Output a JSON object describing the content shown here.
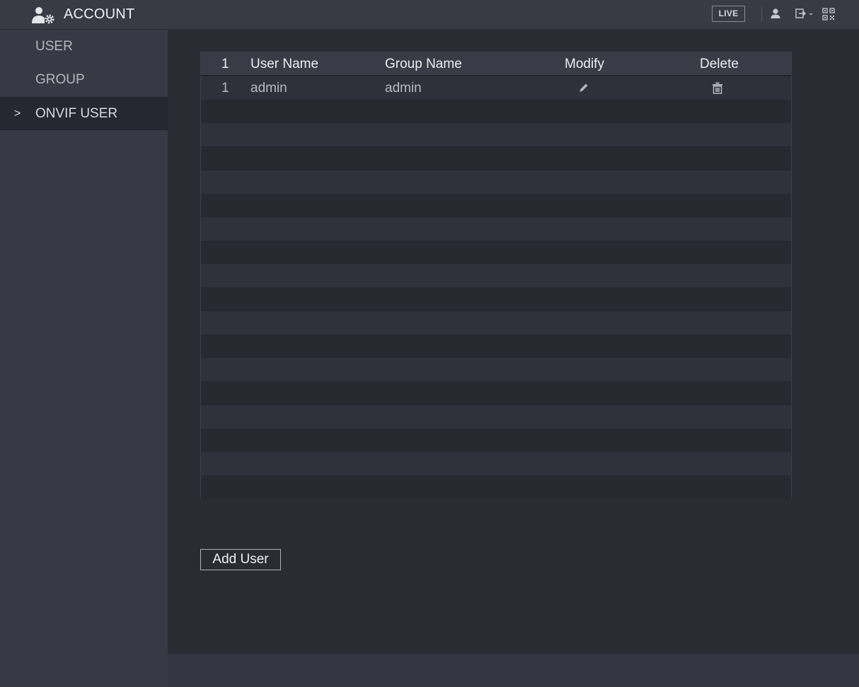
{
  "header": {
    "title": "ACCOUNT",
    "live_label": "LIVE",
    "icons": [
      "account-settings-icon",
      "user-icon",
      "logout-icon",
      "qr-code-icon"
    ]
  },
  "sidebar": {
    "items": [
      {
        "label": "USER",
        "active": false
      },
      {
        "label": "GROUP",
        "active": false
      },
      {
        "label": "ONVIF USER",
        "active": true
      }
    ],
    "active_marker": ">"
  },
  "table": {
    "columns": [
      "1",
      "User Name",
      "Group Name",
      "Modify",
      "Delete"
    ],
    "rows": [
      {
        "index": "1",
        "user_name": "admin",
        "group_name": "admin",
        "modify_icon": "pencil-icon",
        "delete_icon": "trash-icon"
      }
    ],
    "empty_rows": 17
  },
  "actions": {
    "add_user_label": "Add User"
  },
  "colors": {
    "background": "#2a2b33",
    "header": "#393a44",
    "sidebar": "#383944",
    "active_item": "#262730"
  }
}
